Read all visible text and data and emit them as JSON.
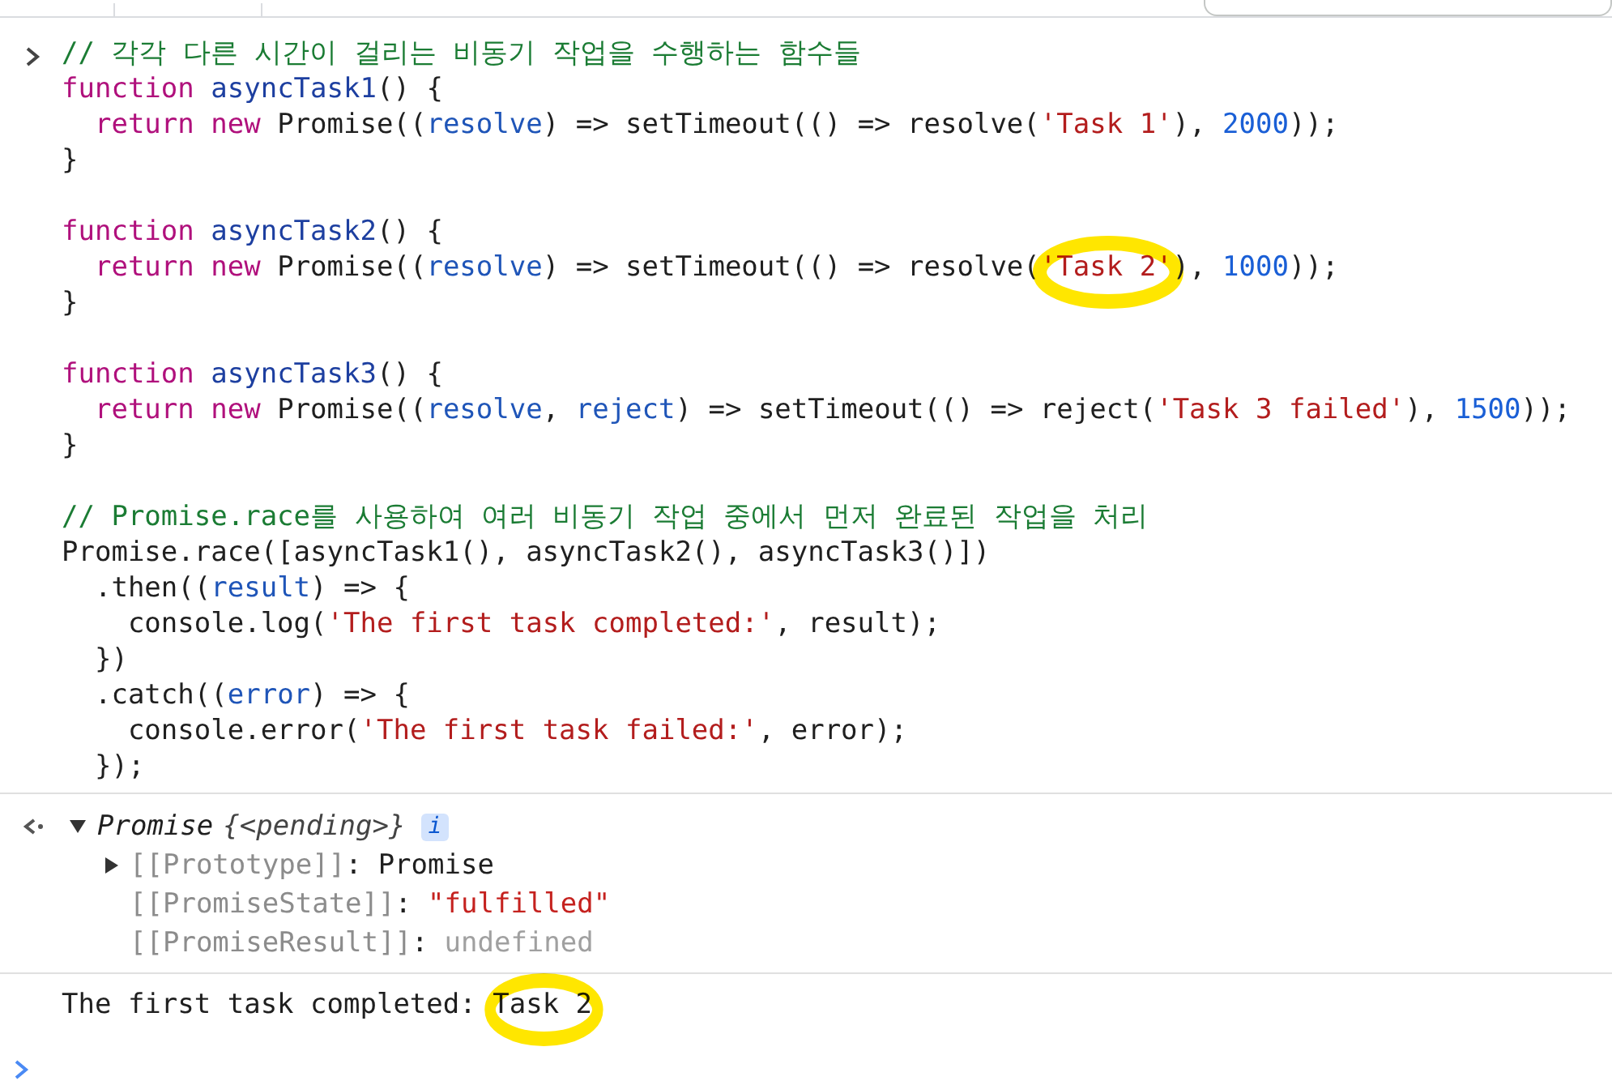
{
  "input": {
    "blocks": [
      [
        {
          "tokens": [
            {
              "kind": "comment",
              "text": "// 각각 다른 시간이 걸리는 비동기 작업을 수행하는 함수들"
            }
          ]
        },
        {
          "tokens": [
            {
              "kind": "keyword",
              "text": "function"
            },
            {
              "kind": "def",
              "text": " asyncTask1"
            },
            {
              "kind": "plain",
              "text": "() {"
            }
          ],
          "children": [
            {
              "tokens": [
                {
                  "kind": "keyword",
                  "text": "return"
                },
                {
                  "kind": "keyword",
                  "text": " new"
                },
                {
                  "kind": "plain",
                  "text": " Promise(("
                },
                {
                  "kind": "param",
                  "text": "resolve"
                },
                {
                  "kind": "plain",
                  "text": ") => setTimeout(() => resolve("
                },
                {
                  "kind": "string",
                  "text": "'Task 1'"
                },
                {
                  "kind": "plain",
                  "text": "), "
                },
                {
                  "kind": "number",
                  "text": "2000"
                },
                {
                  "kind": "plain",
                  "text": "));"
                }
              ]
            }
          ]
        },
        {
          "tokens": [
            {
              "kind": "plain",
              "text": "}"
            }
          ]
        }
      ],
      [
        {
          "tokens": [
            {
              "kind": "keyword",
              "text": "function"
            },
            {
              "kind": "def",
              "text": " asyncTask2"
            },
            {
              "kind": "plain",
              "text": "() {"
            }
          ],
          "children": [
            {
              "tokens": [
                {
                  "kind": "keyword",
                  "text": "return"
                },
                {
                  "kind": "keyword",
                  "text": " new"
                },
                {
                  "kind": "plain",
                  "text": " Promise(("
                },
                {
                  "kind": "param",
                  "text": "resolve"
                },
                {
                  "kind": "plain",
                  "text": ") => setTimeout(() => resolve("
                },
                {
                  "kind": "marked_string",
                  "text": "'Task 2'"
                },
                {
                  "kind": "plain",
                  "text": "), "
                },
                {
                  "kind": "number",
                  "text": "1000"
                },
                {
                  "kind": "plain",
                  "text": "));"
                }
              ]
            }
          ]
        },
        {
          "tokens": [
            {
              "kind": "plain",
              "text": "}"
            }
          ]
        }
      ],
      [
        {
          "tokens": [
            {
              "kind": "keyword",
              "text": "function"
            },
            {
              "kind": "def",
              "text": " asyncTask3"
            },
            {
              "kind": "plain",
              "text": "() {"
            }
          ],
          "children": [
            {
              "tokens": [
                {
                  "kind": "keyword",
                  "text": "return"
                },
                {
                  "kind": "keyword",
                  "text": " new"
                },
                {
                  "kind": "plain",
                  "text": " Promise(("
                },
                {
                  "kind": "param",
                  "text": "resolve"
                },
                {
                  "kind": "plain",
                  "text": ", "
                },
                {
                  "kind": "param",
                  "text": "reject"
                },
                {
                  "kind": "plain",
                  "text": ") => setTimeout(() => reject("
                },
                {
                  "kind": "string",
                  "text": "'Task 3 failed'"
                },
                {
                  "kind": "plain",
                  "text": "), "
                },
                {
                  "kind": "number",
                  "text": "1500"
                },
                {
                  "kind": "plain",
                  "text": "));"
                }
              ]
            }
          ]
        },
        {
          "tokens": [
            {
              "kind": "plain",
              "text": "}"
            }
          ]
        }
      ],
      [
        {
          "tokens": [
            {
              "kind": "comment",
              "text": "// Promise.race를 사용하여 여러 비동기 작업 중에서 먼저 완료된 작업을 처리"
            }
          ]
        },
        {
          "tokens": [
            {
              "kind": "plain",
              "text": "Promise.race([asyncTask1(), asyncTask2(), asyncTask3()])"
            }
          ],
          "children": [
            {
              "tokens": [
                {
                  "kind": "plain",
                  "text": ".then(("
                },
                {
                  "kind": "param",
                  "text": "result"
                },
                {
                  "kind": "plain",
                  "text": ") => {"
                }
              ],
              "children": [
                {
                  "tokens": [
                    {
                      "kind": "plain",
                      "text": "console.log("
                    },
                    {
                      "kind": "string",
                      "text": "'The first task completed:'"
                    },
                    {
                      "kind": "plain",
                      "text": ", result);"
                    }
                  ]
                }
              ]
            },
            {
              "tokens": [
                {
                  "kind": "plain",
                  "text": "})"
                }
              ]
            },
            {
              "tokens": [
                {
                  "kind": "plain",
                  "text": ".catch(("
                },
                {
                  "kind": "param",
                  "text": "error"
                },
                {
                  "kind": "plain",
                  "text": ") => {"
                }
              ],
              "children": [
                {
                  "tokens": [
                    {
                      "kind": "plain",
                      "text": "console.error("
                    },
                    {
                      "kind": "string",
                      "text": "'The first task failed:'"
                    },
                    {
                      "kind": "plain",
                      "text": ", error);"
                    }
                  ]
                }
              ]
            },
            {
              "tokens": [
                {
                  "kind": "plain",
                  "text": "});"
                }
              ]
            }
          ]
        }
      ]
    ]
  },
  "result": {
    "expanded": true,
    "class_name": "Promise",
    "preview": "{<pending>}",
    "info_badge": "i",
    "properties": [
      {
        "key": "[[Prototype]]",
        "separator": ":",
        "value": "Promise",
        "kind": "object",
        "expandable": true
      },
      {
        "key": "[[PromiseState]]",
        "separator": ":",
        "value": "\"fulfilled\"",
        "kind": "string",
        "expandable": false
      },
      {
        "key": "[[PromiseResult]]",
        "separator": ":",
        "value": "undefined",
        "kind": "undefined",
        "expandable": false
      }
    ]
  },
  "log": {
    "message": "The first task completed:",
    "value": "Task 2",
    "value_highlighted": true
  }
}
